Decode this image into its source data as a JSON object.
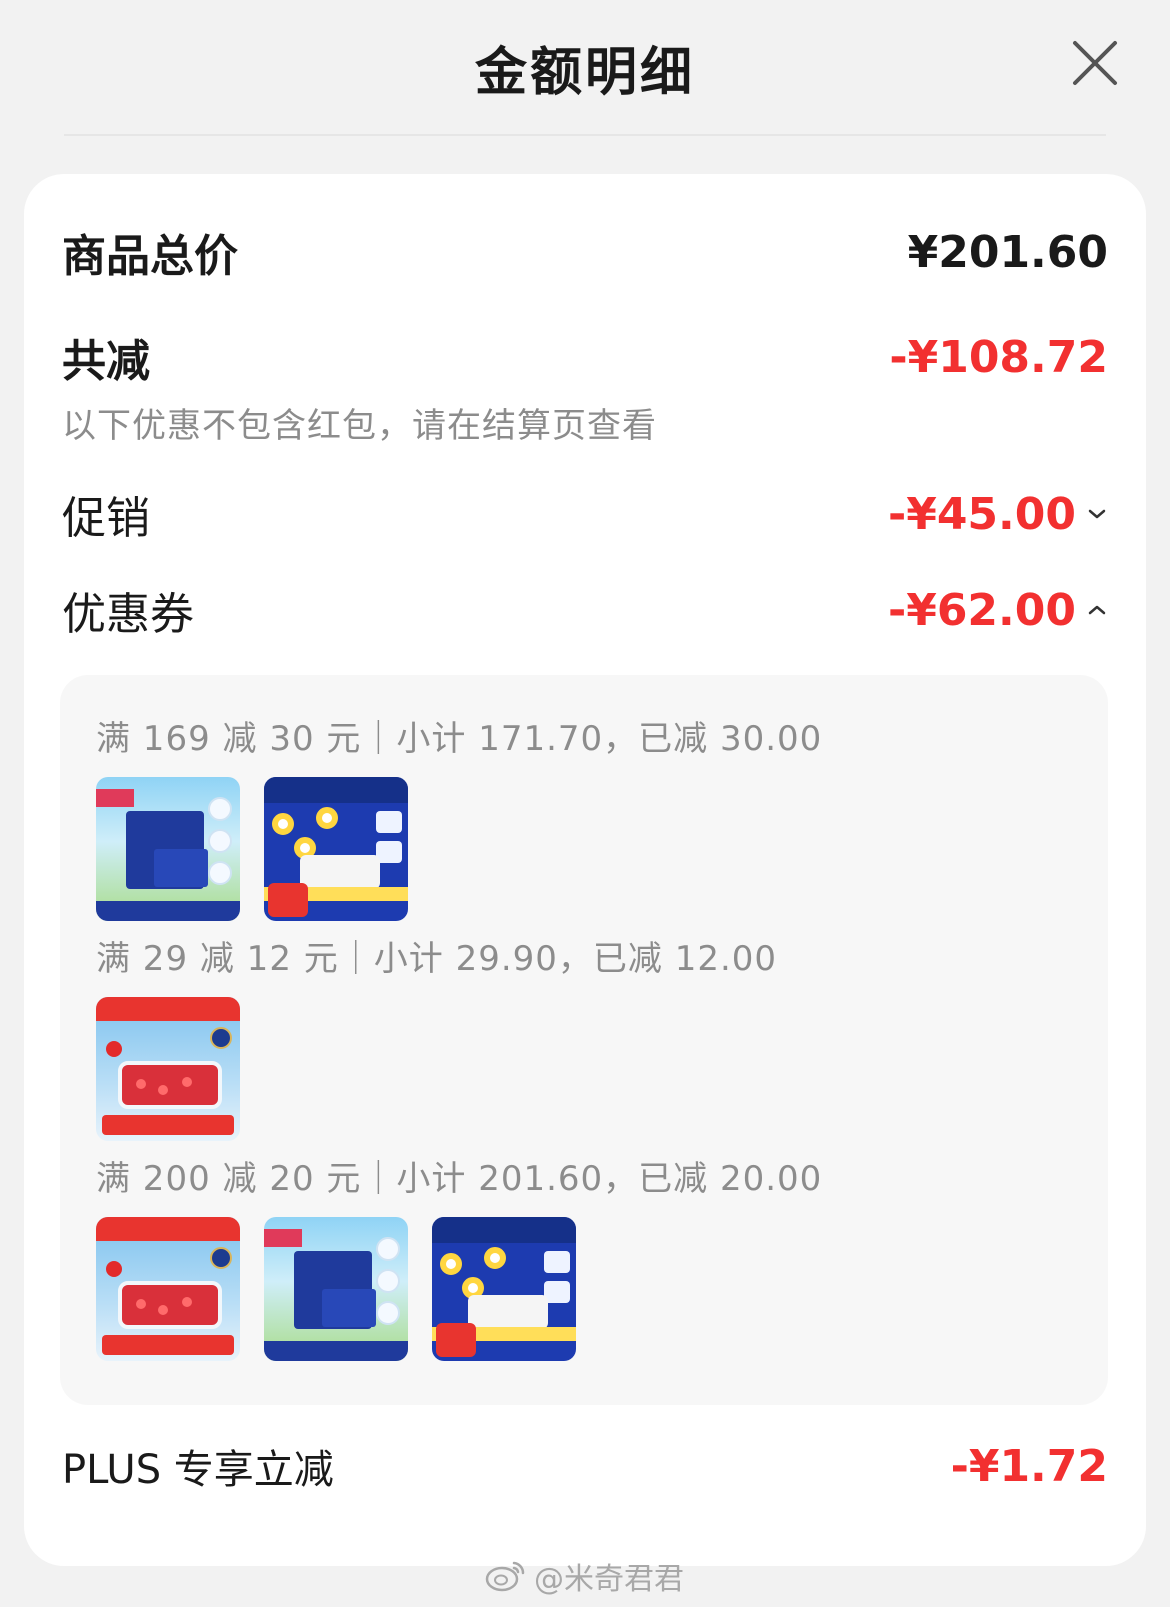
{
  "header": {
    "title": "金额明细"
  },
  "summary": {
    "goods_total_label": "商品总价",
    "goods_total_value": "¥201.60",
    "total_discount_label": "共减",
    "total_discount_value": "-¥108.72",
    "note": "以下优惠不包含红包，请在结算页查看",
    "promotion_label": "促销",
    "promotion_value": "-¥45.00",
    "coupon_label": "优惠券",
    "coupon_value": "-¥62.00"
  },
  "coupon_groups": [
    {
      "title": "满 169 减 30 元｜小计 171.70，已减 30.00",
      "products": [
        "tissue",
        "daisy"
      ]
    },
    {
      "title": "满 29 减 12 元｜小计 29.90，已减 12.00",
      "products": [
        "tomato"
      ]
    },
    {
      "title": "满 200 减 20 元｜小计 201.60，已减 20.00",
      "products": [
        "tomato",
        "tissue",
        "daisy"
      ]
    }
  ],
  "plus": {
    "label": "PLUS 专享立减",
    "value": "-¥1.72"
  },
  "watermark": {
    "text": "@米奇君君"
  },
  "colors": {
    "accent_red": "#f23030",
    "muted_text": "#8c8c8c",
    "background": "#f2f2f2"
  },
  "icons": {
    "close": "close-icon",
    "promotion_toggle": "chevron-down-icon",
    "coupon_toggle": "chevron-up-icon",
    "watermark": "weibo-icon"
  }
}
